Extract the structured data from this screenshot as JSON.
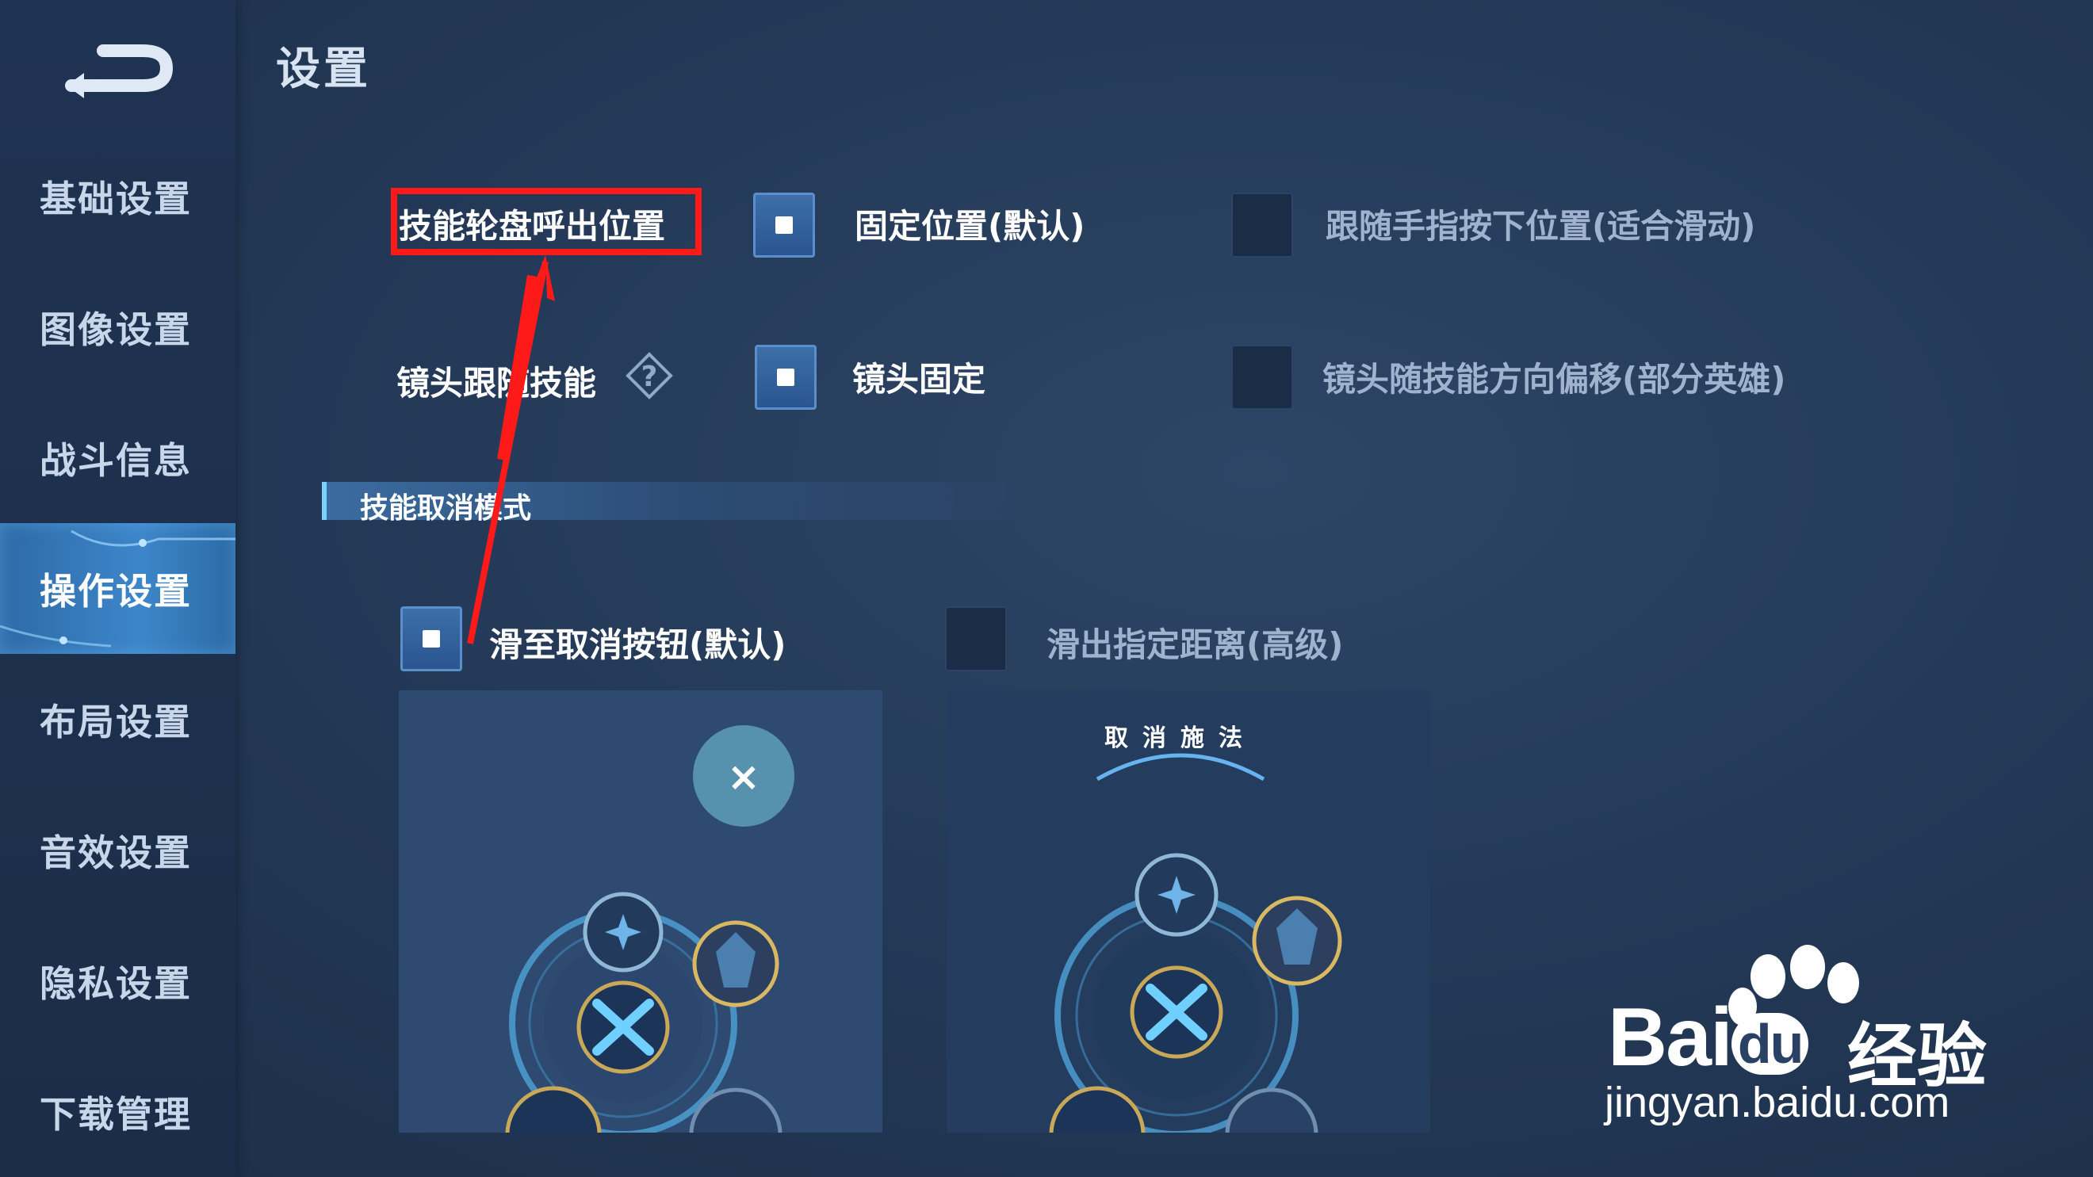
{
  "header": {
    "title": "设置"
  },
  "sidebar": {
    "items": [
      {
        "label": "基础设置"
      },
      {
        "label": "图像设置"
      },
      {
        "label": "战斗信息"
      },
      {
        "label": "操作设置"
      },
      {
        "label": "布局设置"
      },
      {
        "label": "音效设置"
      },
      {
        "label": "隐私设置"
      },
      {
        "label": "下载管理"
      }
    ],
    "active_index": 3
  },
  "settings": {
    "skill_wheel": {
      "label": "技能轮盘呼出位置",
      "option_fixed": "固定位置(默认)",
      "option_follow": "跟随手指按下位置(适合滑动)",
      "selected": "option_fixed"
    },
    "camera": {
      "label": "镜头跟随技能",
      "option_fixed": "镜头固定",
      "option_offset": "镜头随技能方向偏移(部分英雄)",
      "selected": "option_fixed"
    },
    "cancel_mode": {
      "section_title": "技能取消模式",
      "option_default": "滑至取消按钮(默认)",
      "option_advanced": "滑出指定距离(高级)",
      "selected": "option_default",
      "preview_right_text": "取消施法"
    }
  },
  "watermark": {
    "logo": "Bai",
    "logo_du": "du",
    "logo_cn": "经验",
    "url": "jingyan.baidu.com"
  },
  "colors": {
    "accent": "#3d86c9",
    "highlight": "#ff1a1a",
    "background": "#243a58"
  }
}
